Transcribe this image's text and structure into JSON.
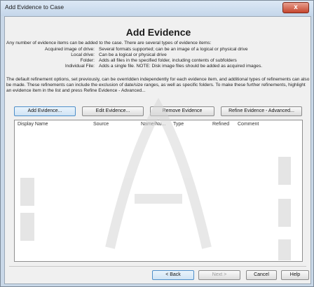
{
  "window": {
    "title": "Add Evidence to Case",
    "close_glyph": "x"
  },
  "heading": "Add Evidence",
  "intro": "Any number of evidence items can be added to the case. There are several types of evidence items:",
  "evidence_types": [
    {
      "name": "Acquired image of drive:",
      "desc": "Several formats supported; can be an image of a logical or physical drive"
    },
    {
      "name": "Local drive:",
      "desc": "Can be a logical or physical drive"
    },
    {
      "name": "Folder:",
      "desc": "Adds all files in the specified folder, including contents of subfolders"
    },
    {
      "name": "Individual File:",
      "desc": "Adds a single file.  NOTE: Disk image files should be added as acquired images."
    }
  ],
  "refinement_text": "The default refinement options, set previously, can be overridden independently for each evidence item, and additional types of refinements can also be made. These refinements can include the exclusion of date/size ranges, as well as specific folders. To make these further refinements, highlight an evidence item in the list and press Refine Evidence - Advanced...",
  "actions": {
    "add": "Add Evidence...",
    "edit": "Edit Evidence...",
    "remove": "Remove Evidence",
    "refine": "Refine Evidence - Advanced..."
  },
  "list": {
    "columns": [
      "Display Name",
      "Source",
      "Name/Nu...",
      "Type",
      "Refined",
      "Comment"
    ]
  },
  "nav": {
    "back": "< Back",
    "next": "Next >",
    "cancel": "Cancel",
    "help": "Help"
  },
  "colors": {
    "window_frame": "#c9d8e8",
    "close_button": "#c5452e",
    "focused_button": "#4f8fc9"
  },
  "icons": [
    "close-icon"
  ]
}
